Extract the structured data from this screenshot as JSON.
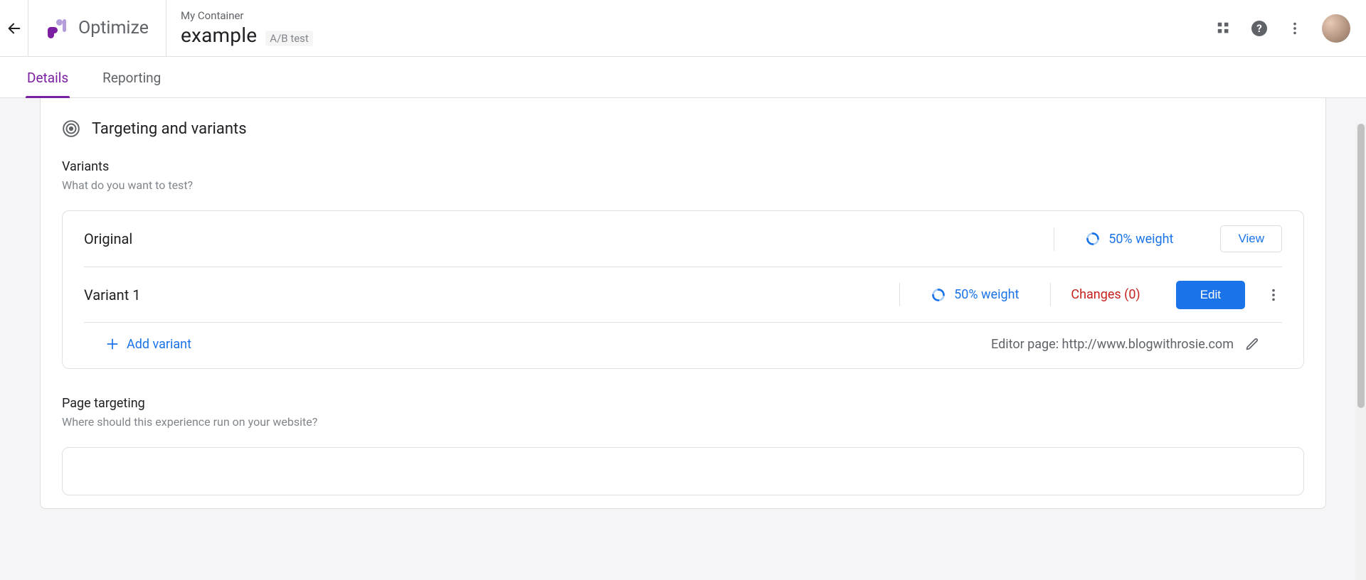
{
  "header": {
    "product": "Optimize",
    "container": "My Container",
    "experiment": "example",
    "experiment_type": "A/B test"
  },
  "tabs": {
    "details": "Details",
    "reporting": "Reporting",
    "active": "details"
  },
  "section": {
    "title": "Targeting and variants"
  },
  "variants": {
    "heading": "Variants",
    "subtext": "What do you want to test?",
    "rows": [
      {
        "name": "Original",
        "weight": "50% weight",
        "view_label": "View"
      },
      {
        "name": "Variant 1",
        "weight": "50% weight",
        "changes": "Changes (0)",
        "edit_label": "Edit"
      }
    ],
    "add_label": "Add variant",
    "editor_label": "Editor page: http://www.blogwithrosie.com"
  },
  "page_targeting": {
    "heading": "Page targeting",
    "subtext": "Where should this experience run on your website?"
  },
  "colors": {
    "accent": "#7b1fa2",
    "blue": "#1a73e8",
    "red": "#c5221f"
  }
}
